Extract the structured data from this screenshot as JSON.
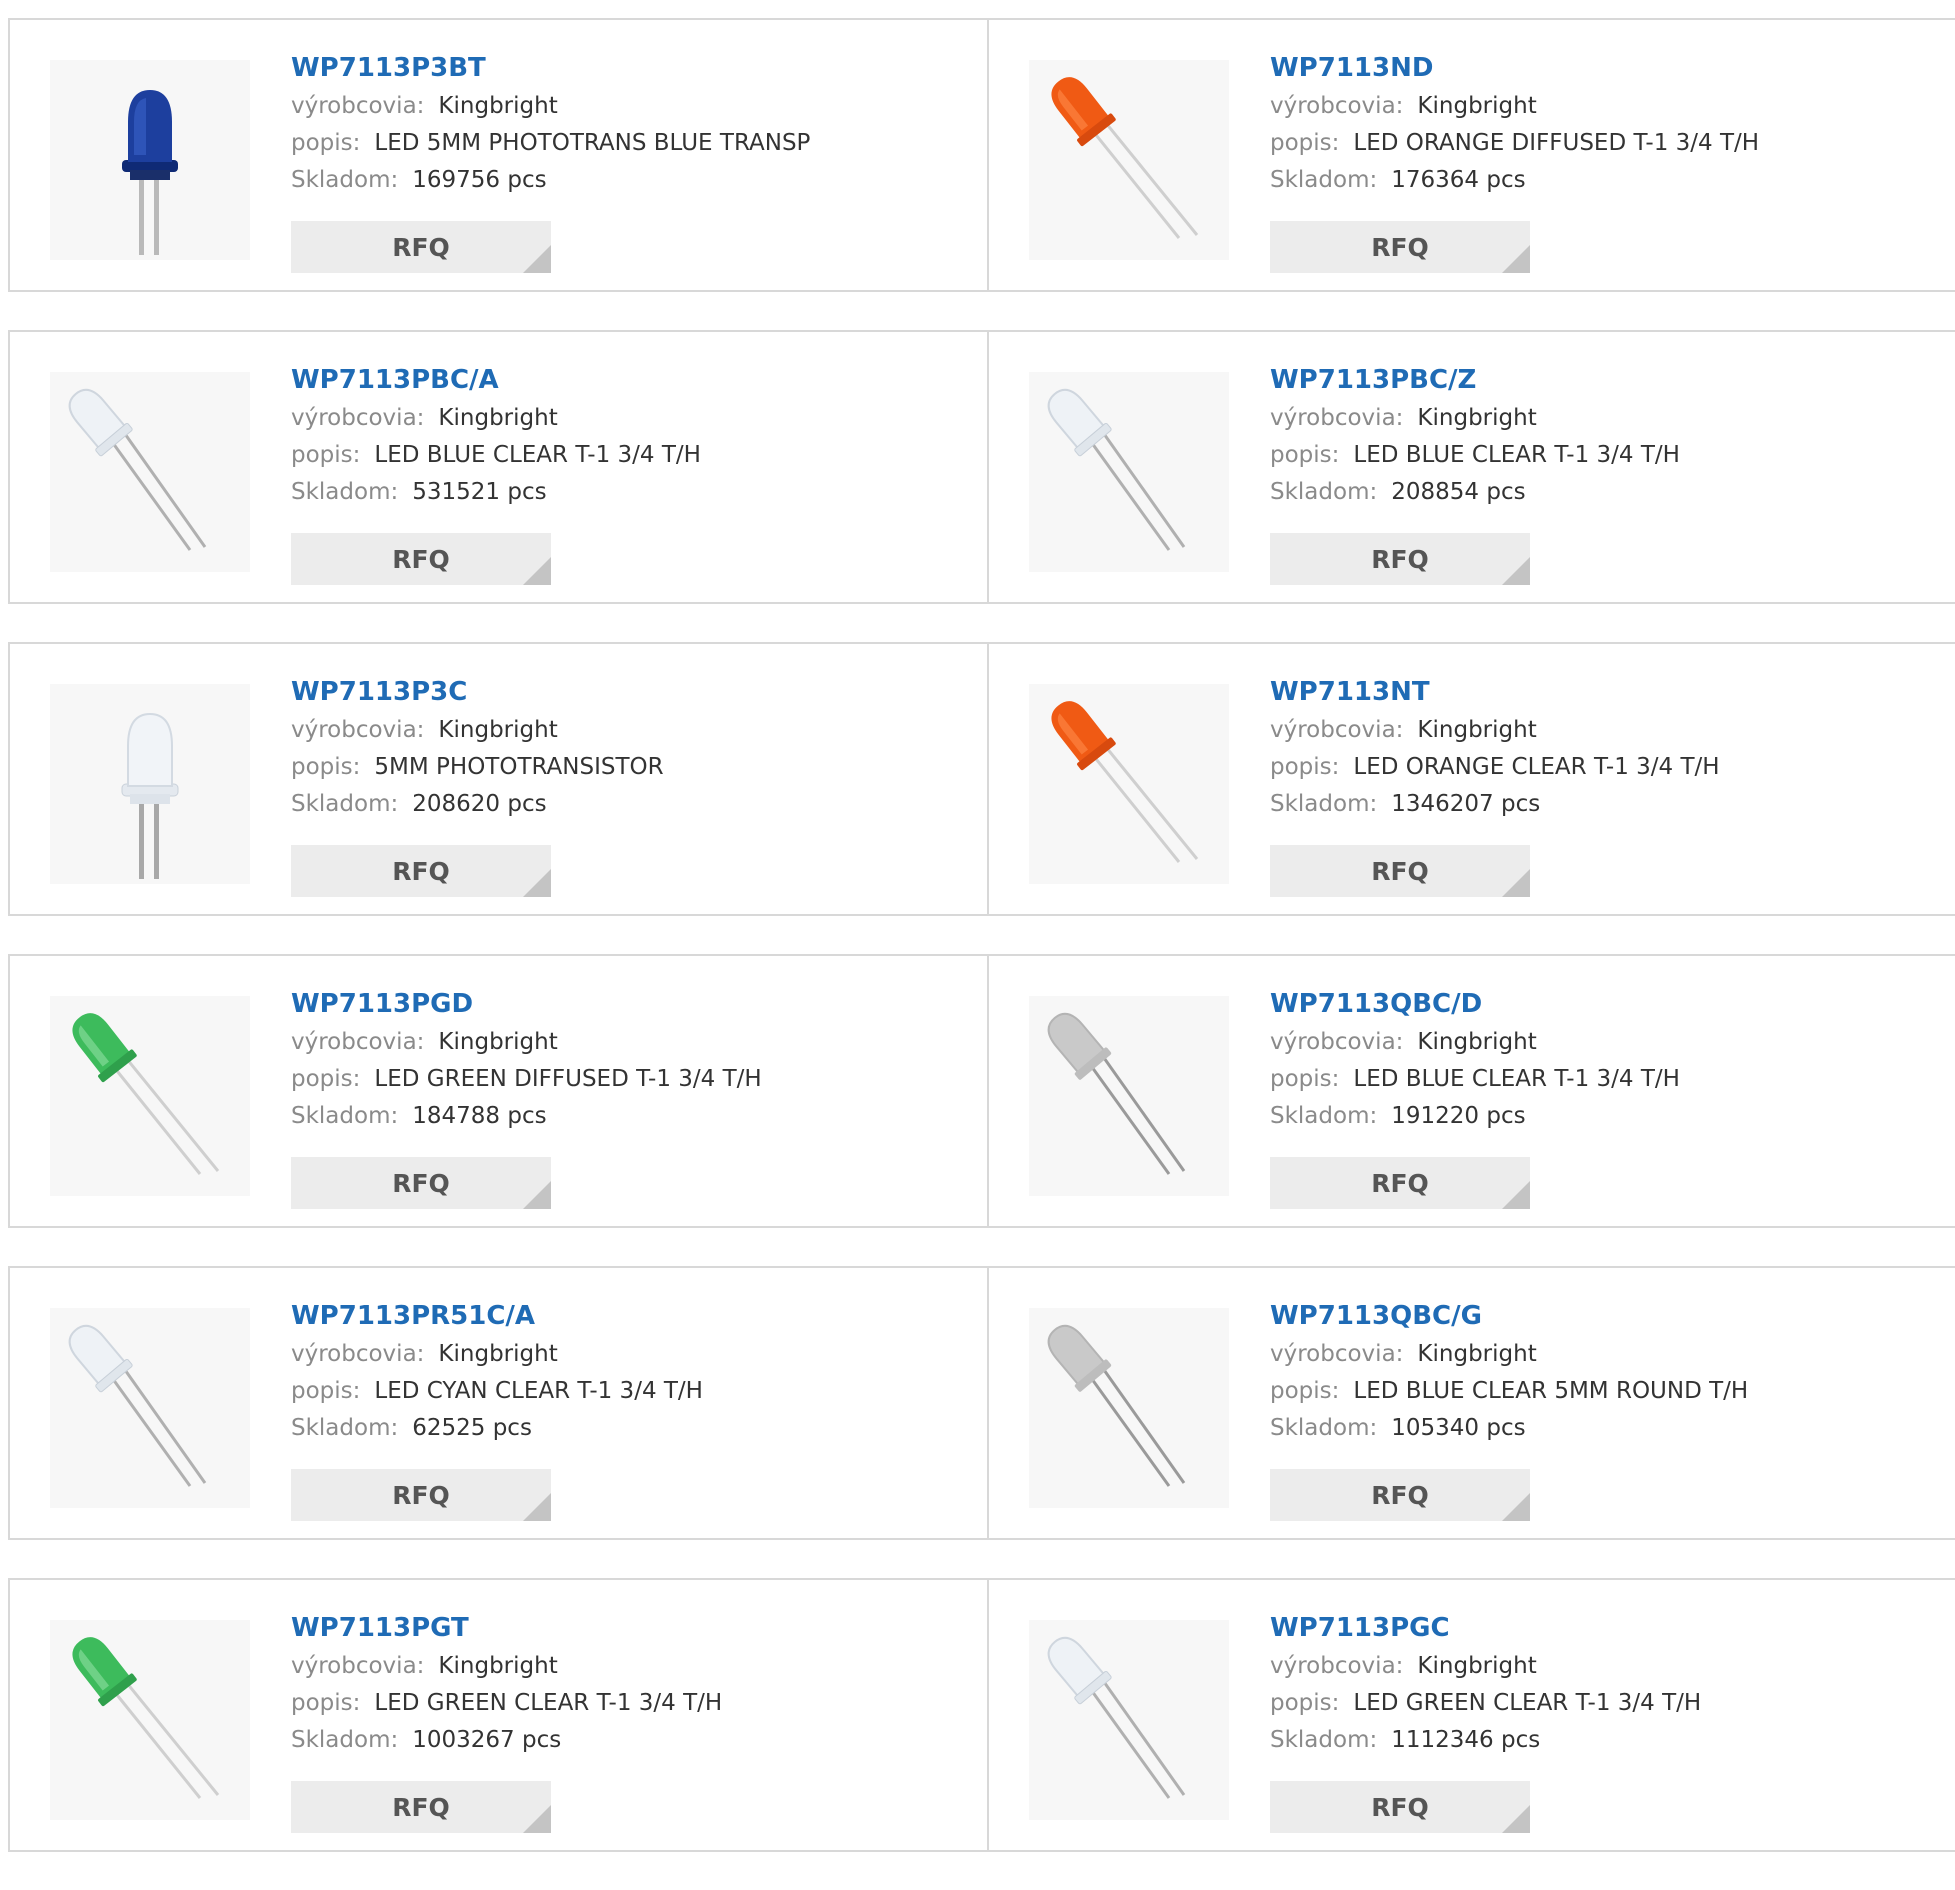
{
  "labels": {
    "manufacturer": "výrobcovia:",
    "description": "popis:",
    "stock": "Skladom:",
    "rfq": "RFQ"
  },
  "colors": {
    "part_link": "#1f6bb5",
    "border": "#d8d8d8",
    "button_bg": "#ececec",
    "label_text": "#8a8a8a"
  },
  "products": [
    {
      "part": "WP7113P3BT",
      "manufacturer": "Kingbright",
      "description": "LED 5MM PHOTOTRANS BLUE TRANSP",
      "stock": "169756 pcs",
      "image": "led-dark-blue-upright-icon"
    },
    {
      "part": "WP7113ND",
      "manufacturer": "Kingbright",
      "description": "LED ORANGE DIFFUSED T-1 3/4 T/H",
      "stock": "176364 pcs",
      "image": "led-orange-angled-icon"
    },
    {
      "part": "WP7113PBC/A",
      "manufacturer": "Kingbright",
      "description": "LED BLUE CLEAR T-1 3/4 T/H",
      "stock": "531521 pcs",
      "image": "led-clear-angled-icon"
    },
    {
      "part": "WP7113PBC/Z",
      "manufacturer": "Kingbright",
      "description": "LED BLUE CLEAR T-1 3/4 T/H",
      "stock": "208854 pcs",
      "image": "led-clear-angled-icon"
    },
    {
      "part": "WP7113P3C",
      "manufacturer": "Kingbright",
      "description": "5MM PHOTOTRANSISTOR",
      "stock": "208620 pcs",
      "image": "led-clear-upright-icon"
    },
    {
      "part": "WP7113NT",
      "manufacturer": "Kingbright",
      "description": "LED ORANGE CLEAR T-1 3/4 T/H",
      "stock": "1346207 pcs",
      "image": "led-orange-angled-icon"
    },
    {
      "part": "WP7113PGD",
      "manufacturer": "Kingbright",
      "description": "LED GREEN DIFFUSED T-1 3/4 T/H",
      "stock": "184788 pcs",
      "image": "led-green-angled-icon"
    },
    {
      "part": "WP7113QBC/D",
      "manufacturer": "Kingbright",
      "description": "LED BLUE CLEAR T-1 3/4 T/H",
      "stock": "191220 pcs",
      "image": "led-grey-angled-icon"
    },
    {
      "part": "WP7113PR51C/A",
      "manufacturer": "Kingbright",
      "description": "LED CYAN CLEAR T-1 3/4 T/H",
      "stock": "62525 pcs",
      "image": "led-clear-angled-icon"
    },
    {
      "part": "WP7113QBC/G",
      "manufacturer": "Kingbright",
      "description": "LED BLUE CLEAR 5MM ROUND T/H",
      "stock": "105340 pcs",
      "image": "led-grey-angled-icon"
    },
    {
      "part": "WP7113PGT",
      "manufacturer": "Kingbright",
      "description": "LED GREEN CLEAR T-1 3/4 T/H",
      "stock": "1003267 pcs",
      "image": "led-green-angled-icon"
    },
    {
      "part": "WP7113PGC",
      "manufacturer": "Kingbright",
      "description": "LED GREEN CLEAR T-1 3/4 T/H",
      "stock": "1112346 pcs",
      "image": "led-clear-angled-icon"
    }
  ]
}
